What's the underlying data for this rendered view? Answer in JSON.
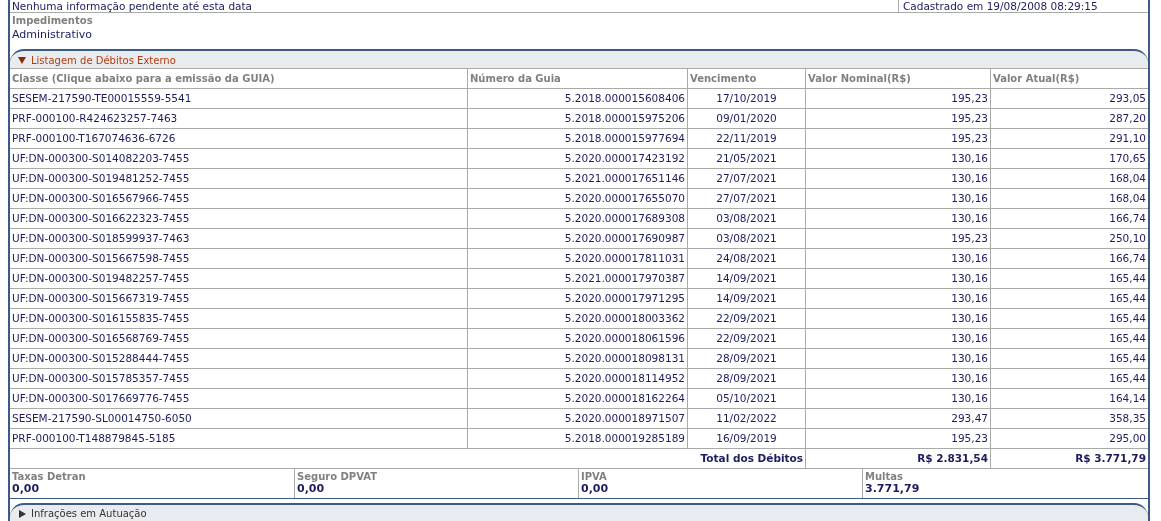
{
  "top_row": {
    "left": "Nenhuma informação pendente até esta data",
    "right": "Cadastrado em 19/08/2008 08:29:15"
  },
  "impedimentos": {
    "label": "Impedimentos",
    "value": "Administrativo"
  },
  "section": {
    "title": "Listagem de Débitos Externo",
    "expanded": true
  },
  "table": {
    "columns": [
      "Classe (Clique abaixo para a emissão da GUIA)",
      "Número da Guia",
      "Vencimento",
      "Valor Nominal(R$)",
      "Valor Atual(R$)"
    ],
    "rows": [
      [
        "SESEM-217590-TE00015559-5541",
        "5.2018.000015608406",
        "17/10/2019",
        "195,23",
        "293,05"
      ],
      [
        "PRF-000100-R424623257-7463",
        "5.2018.000015975206",
        "09/01/2020",
        "195,23",
        "287,20"
      ],
      [
        "PRF-000100-T167074636-6726",
        "5.2018.000015977694",
        "22/11/2019",
        "195,23",
        "291,10"
      ],
      [
        "UF:DN-000300-S014082203-7455",
        "5.2020.000017423192",
        "21/05/2021",
        "130,16",
        "170,65"
      ],
      [
        "UF:DN-000300-S019481252-7455",
        "5.2021.000017651146",
        "27/07/2021",
        "130,16",
        "168,04"
      ],
      [
        "UF:DN-000300-S016567966-7455",
        "5.2020.000017655070",
        "27/07/2021",
        "130,16",
        "168,04"
      ],
      [
        "UF:DN-000300-S016622323-7455",
        "5.2020.000017689308",
        "03/08/2021",
        "130,16",
        "166,74"
      ],
      [
        "UF:DN-000300-S018599937-7463",
        "5.2020.000017690987",
        "03/08/2021",
        "195,23",
        "250,10"
      ],
      [
        "UF:DN-000300-S015667598-7455",
        "5.2020.000017811031",
        "24/08/2021",
        "130,16",
        "166,74"
      ],
      [
        "UF:DN-000300-S019482257-7455",
        "5.2021.000017970387",
        "14/09/2021",
        "130,16",
        "165,44"
      ],
      [
        "UF:DN-000300-S015667319-7455",
        "5.2020.000017971295",
        "14/09/2021",
        "130,16",
        "165,44"
      ],
      [
        "UF:DN-000300-S016155835-7455",
        "5.2020.000018003362",
        "22/09/2021",
        "130,16",
        "165,44"
      ],
      [
        "UF:DN-000300-S016568769-7455",
        "5.2020.000018061596",
        "22/09/2021",
        "130,16",
        "165,44"
      ],
      [
        "UF:DN-000300-S015288444-7455",
        "5.2020.000018098131",
        "28/09/2021",
        "130,16",
        "165,44"
      ],
      [
        "UF:DN-000300-S015785357-7455",
        "5.2020.000018114952",
        "28/09/2021",
        "130,16",
        "165,44"
      ],
      [
        "UF:DN-000300-S017669776-7455",
        "5.2020.000018162264",
        "05/10/2021",
        "130,16",
        "164,14"
      ],
      [
        "SESEM-217590-SL00014750-6050",
        "5.2020.000018971507",
        "11/02/2022",
        "293,47",
        "358,35"
      ],
      [
        "PRF-000100-T148879845-5185",
        "5.2018.000019285189",
        "16/09/2019",
        "195,23",
        "295,00"
      ]
    ],
    "total": {
      "label": "Total dos Débitos",
      "nominal": "R$ 2.831,54",
      "atual": "R$ 3.771,79"
    }
  },
  "summary": [
    {
      "label": "Taxas Detran",
      "value": "0,00"
    },
    {
      "label": "Seguro DPVAT",
      "value": "0,00"
    },
    {
      "label": "IPVA",
      "value": "0,00"
    },
    {
      "label": "Multas",
      "value": "3.771,79"
    }
  ],
  "next_section": {
    "title": "Infrações em Autuação",
    "expanded": false
  }
}
